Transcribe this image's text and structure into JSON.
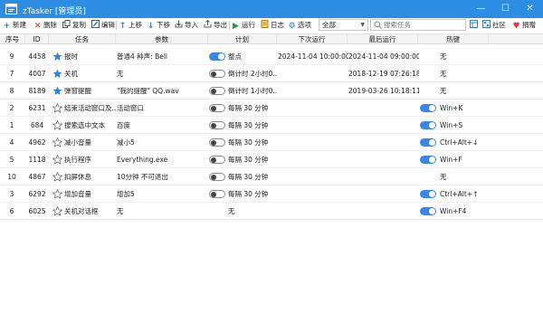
{
  "window": {
    "title": "zTasker [管理员]"
  },
  "toolbar": {
    "new": "新建",
    "delete": "删除",
    "copy": "复制",
    "edit": "编辑",
    "up": "上移",
    "down": "下移",
    "import": "导入",
    "export": "导出",
    "run": "运行",
    "log": "日志",
    "options": "选项",
    "filter": "全部",
    "search_placeholder": "搜索任务",
    "community": "社区",
    "donate": "捐赠"
  },
  "columns": {
    "seq": "序号",
    "id": "ID",
    "task": "任务",
    "params": "参数",
    "plan": "计划",
    "next": "下次运行",
    "last": "最后运行",
    "hotkey": "热键"
  },
  "colors": {
    "titlebar": "#2c8de3",
    "toggle_on": "#3a86e8",
    "star_filled": "#2f86e0"
  },
  "rows": [
    {
      "seq": "9",
      "id": "4458",
      "task": "报时",
      "star": true,
      "params": "普通4 种声: Bell",
      "plan_on": true,
      "plan": "整点",
      "next": "2024-11-04 10:00:00",
      "last": "2024-11-04 09:00:00",
      "hk_toggle": false,
      "hotkey": "无"
    },
    {
      "seq": "7",
      "id": "4007",
      "task": "关机",
      "star": true,
      "params": "无",
      "plan_on": false,
      "plan": "倒计时 2小时0...",
      "next": "",
      "last": "2018-12-19 07:26:18",
      "hk_toggle": false,
      "hotkey": "无"
    },
    {
      "seq": "8",
      "id": "8189",
      "task": "弹窗提醒",
      "star": true,
      "params": "\"我的提醒\" QQ.wav",
      "plan_on": false,
      "plan": "倒计时 1小时0...",
      "next": "",
      "last": "2019-03-26 10:18:11",
      "hk_toggle": false,
      "hotkey": "无"
    },
    {
      "seq": "2",
      "id": "6231",
      "task": "结束活动窗口及...",
      "star": false,
      "params": "活动窗口",
      "plan_on": false,
      "plan": "每隔 30 分钟",
      "next": "",
      "last": "",
      "hk_toggle": true,
      "hotkey": "Win+K"
    },
    {
      "seq": "1",
      "id": "684",
      "task": "搜索选中文本",
      "star": false,
      "params": "百度",
      "plan_on": false,
      "plan": "每隔 30 分钟",
      "next": "",
      "last": "",
      "hk_toggle": true,
      "hotkey": "Win+S"
    },
    {
      "seq": "4",
      "id": "4962",
      "task": "减小音量",
      "star": false,
      "params": "减小5",
      "plan_on": false,
      "plan": "每隔 30 分钟",
      "next": "",
      "last": "",
      "hk_toggle": true,
      "hotkey": "Ctrl+Alt+↓"
    },
    {
      "seq": "5",
      "id": "1118",
      "task": "执行程序",
      "star": false,
      "params": "Everything.exe",
      "plan_on": false,
      "plan": "每隔 30 分钟",
      "next": "",
      "last": "",
      "hk_toggle": true,
      "hotkey": "Win+F"
    },
    {
      "seq": "10",
      "id": "4867",
      "task": "扣屏休息",
      "star": false,
      "params": "10分钟 不可退出",
      "plan_on": false,
      "plan": "每隔 30 分钟",
      "next": "",
      "last": "",
      "hk_toggle": false,
      "hotkey": "无"
    },
    {
      "seq": "3",
      "id": "6292",
      "task": "增加音量",
      "star": false,
      "params": "增加5",
      "plan_on": false,
      "plan": "每隔 30 分钟",
      "next": "",
      "last": "",
      "hk_toggle": true,
      "hotkey": "Ctrl+Alt+↑"
    },
    {
      "seq": "6",
      "id": "6025",
      "task": "关机对话框",
      "star": false,
      "params": "无",
      "plan_on": null,
      "plan": "无",
      "next": "",
      "last": "",
      "hk_toggle": true,
      "hotkey": "Win+F4"
    }
  ]
}
